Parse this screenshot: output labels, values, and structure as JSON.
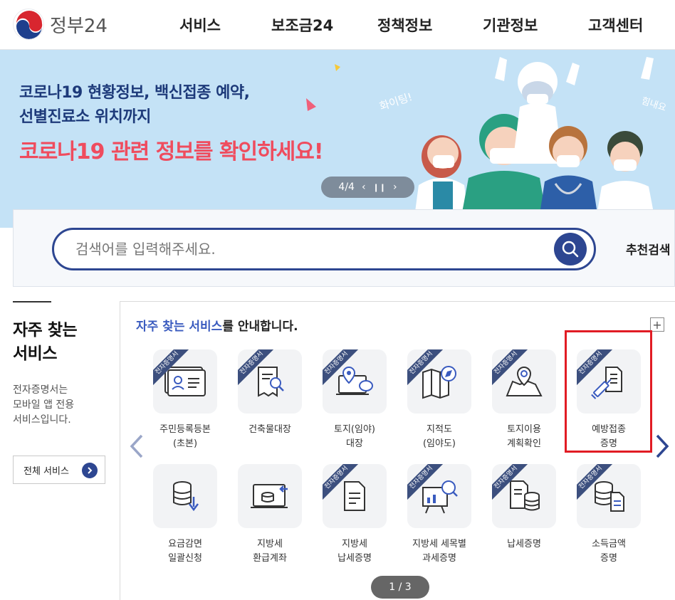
{
  "header": {
    "logo_text": "정부24",
    "nav": [
      "서비스",
      "보조금24",
      "정책정보",
      "기관정보",
      "고객센터"
    ]
  },
  "banner": {
    "subtitle_line1": "코로나19 현황정보, 백신접종 예약,",
    "subtitle_line2": "선별진료소 위치까지",
    "headline": "코로나19 관련 정보를 확인하세요!",
    "slide_indicator": "4/4",
    "art_text_1": "화이팅!",
    "art_text_2": "힘내요"
  },
  "search": {
    "placeholder": "검색어를 입력해주세요.",
    "recommend_label": "추천검색"
  },
  "left": {
    "title_line1": "자주 찾는",
    "title_line2": "서비스",
    "desc_line1": "전자증명서는",
    "desc_line2": "모바일 앱 전용",
    "desc_line3": "서비스입니다.",
    "all_services_button": "전체 서비스"
  },
  "panel": {
    "title_highlight": "자주 찾는 서비스",
    "title_rest": "를 안내합니다.",
    "plus": "+",
    "ribbon_text": "전자증명서",
    "pager": "1 / 3"
  },
  "services": [
    {
      "label": "주민등록등본\n(초본)",
      "icon": "id-card-icon",
      "ribbon": true
    },
    {
      "label": "건축물대장",
      "icon": "building-register-icon",
      "ribbon": true
    },
    {
      "label": "토지(임야)\n대장",
      "icon": "land-register-icon",
      "ribbon": true
    },
    {
      "label": "지적도\n(임야도)",
      "icon": "cadastral-map-icon",
      "ribbon": true
    },
    {
      "label": "토지이용\n계획확인",
      "icon": "land-use-map-icon",
      "ribbon": true
    },
    {
      "label": "예방접종\n증명",
      "icon": "vaccination-icon",
      "ribbon": true
    },
    {
      "label": "요금감면\n일괄신청",
      "icon": "fee-reduction-icon",
      "ribbon": false
    },
    {
      "label": "지방세\n환급계좌",
      "icon": "refund-account-icon",
      "ribbon": false
    },
    {
      "label": "지방세\n납세증명",
      "icon": "local-tax-certificate-icon",
      "ribbon": true
    },
    {
      "label": "지방세 세목별\n과세증명",
      "icon": "tax-item-certificate-icon",
      "ribbon": true
    },
    {
      "label": "납세증명",
      "icon": "tax-payment-icon",
      "ribbon": true
    },
    {
      "label": "소득금액\n증명",
      "icon": "income-certificate-icon",
      "ribbon": true
    }
  ],
  "colors": {
    "brand_navy": "#2d4691",
    "banner_bg": "#c4e2f6",
    "headline_red": "#ef4c5e",
    "highlight_red": "#e11c24"
  }
}
